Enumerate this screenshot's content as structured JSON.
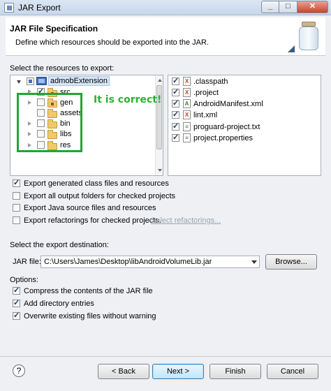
{
  "window": {
    "title": "JAR Export"
  },
  "banner": {
    "title": "JAR File Specification",
    "description": "Define which resources should be exported into the JAR."
  },
  "resources_section": {
    "label": "Select the resources to export:"
  },
  "tree": {
    "project": "admobExtension",
    "children": [
      "src",
      "gen",
      "assets",
      "bin",
      "libs",
      "res"
    ]
  },
  "files": [
    ".classpath",
    ".project",
    "AndroidManifest.xml",
    "lint.xml",
    "proguard-project.txt",
    "project.properties"
  ],
  "annotation": {
    "text": "It is correct!",
    "color": "#2fb032"
  },
  "options_checks": [
    "Export generated class files and resources",
    "Export all output folders for checked projects",
    "Export Java source files and resources",
    "Export refactorings for checked projects."
  ],
  "select_refactorings_link": "Select refactorings...",
  "destination": {
    "label": "Select the export destination:",
    "jar_label": "JAR file:",
    "jar_value": "C:\\Users\\James\\Desktop\\libAndroidVolumeLib.jar",
    "browse": "Browse..."
  },
  "options": {
    "label": "Options:",
    "items": [
      "Compress the contents of the JAR file",
      "Add directory entries",
      "Overwrite existing files without warning"
    ]
  },
  "buttons": {
    "help": "?",
    "back": "< Back",
    "next": "Next >",
    "finish": "Finish",
    "cancel": "Cancel"
  }
}
